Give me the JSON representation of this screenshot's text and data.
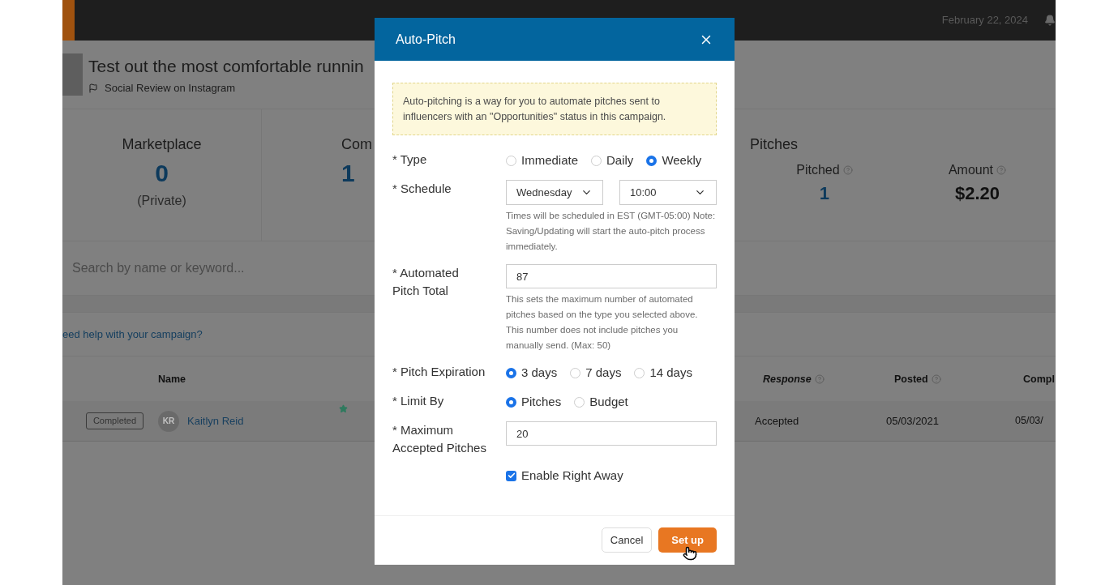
{
  "topbar": {
    "date": "February 22, 2024"
  },
  "campaign": {
    "title": "Test out the most comfortable runnin",
    "subtitle": "Social Review on Instagram"
  },
  "stats": [
    {
      "label": "Marketplace",
      "value": "0",
      "note": "(Private)"
    },
    {
      "label": "Com",
      "value": "1"
    }
  ],
  "pitches": {
    "title": "Pitches",
    "items": [
      {
        "label": "Pitched",
        "value": "1",
        "kind": "count"
      },
      {
        "label": "Amount",
        "value": "$2.20",
        "kind": "money"
      }
    ]
  },
  "search": {
    "placeholder": "Search by name or keyword..."
  },
  "help_link": "eed help with your campaign?",
  "table": {
    "columns": [
      {
        "label": "Name",
        "italic": false,
        "help": false
      },
      {
        "label": "Response",
        "italic": true,
        "help": true
      },
      {
        "label": "Posted",
        "italic": false,
        "help": true
      },
      {
        "label": "Compl",
        "italic": false,
        "help": false
      }
    ],
    "rows": [
      {
        "status": "Completed",
        "initials": "KR",
        "starred": true,
        "cells": [
          "Kaitlyn Reid",
          "Accepted",
          "05/03/2021",
          "05/03/"
        ]
      }
    ]
  },
  "modal": {
    "title": "Auto-Pitch",
    "info": "Auto-pitching is a way for you to automate pitches sent to influencers with an \"Opportunities\" status in this campaign.",
    "fields": [
      {
        "kind": "radio",
        "label": "* Type",
        "options": [
          {
            "label": "Immediate",
            "selected": false
          },
          {
            "label": "Daily",
            "selected": false
          },
          {
            "label": "Weekly",
            "selected": true
          }
        ]
      },
      {
        "kind": "selects",
        "label": "* Schedule",
        "selects": [
          "Wednesday",
          "10:00"
        ],
        "help": "Times will be scheduled in EST (GMT-05:00) Note: Saving/Updating will start the auto-pitch process immediately."
      },
      {
        "kind": "input",
        "label": "* Automated Pitch Total",
        "value": "87",
        "help": "This sets the maximum number of automated pitches based on the type you selected above. This number does not include pitches you manually send. (Max: 50)"
      },
      {
        "kind": "radio",
        "label": "* Pitch Expiration",
        "options": [
          {
            "label": "3 days",
            "selected": true
          },
          {
            "label": "7 days",
            "selected": false
          },
          {
            "label": "14 days",
            "selected": false
          }
        ]
      },
      {
        "kind": "radio",
        "label": "* Limit By",
        "options": [
          {
            "label": "Pitches",
            "selected": true
          },
          {
            "label": "Budget",
            "selected": false
          }
        ]
      },
      {
        "kind": "input",
        "label": "* Maximum Accepted Pitches",
        "value": "20"
      },
      {
        "kind": "checkbox",
        "label": "Enable Right Away",
        "checked": true
      }
    ],
    "buttons": [
      {
        "label": "Cancel",
        "kind": "secondary"
      },
      {
        "label": "Set up",
        "kind": "primary"
      }
    ]
  }
}
